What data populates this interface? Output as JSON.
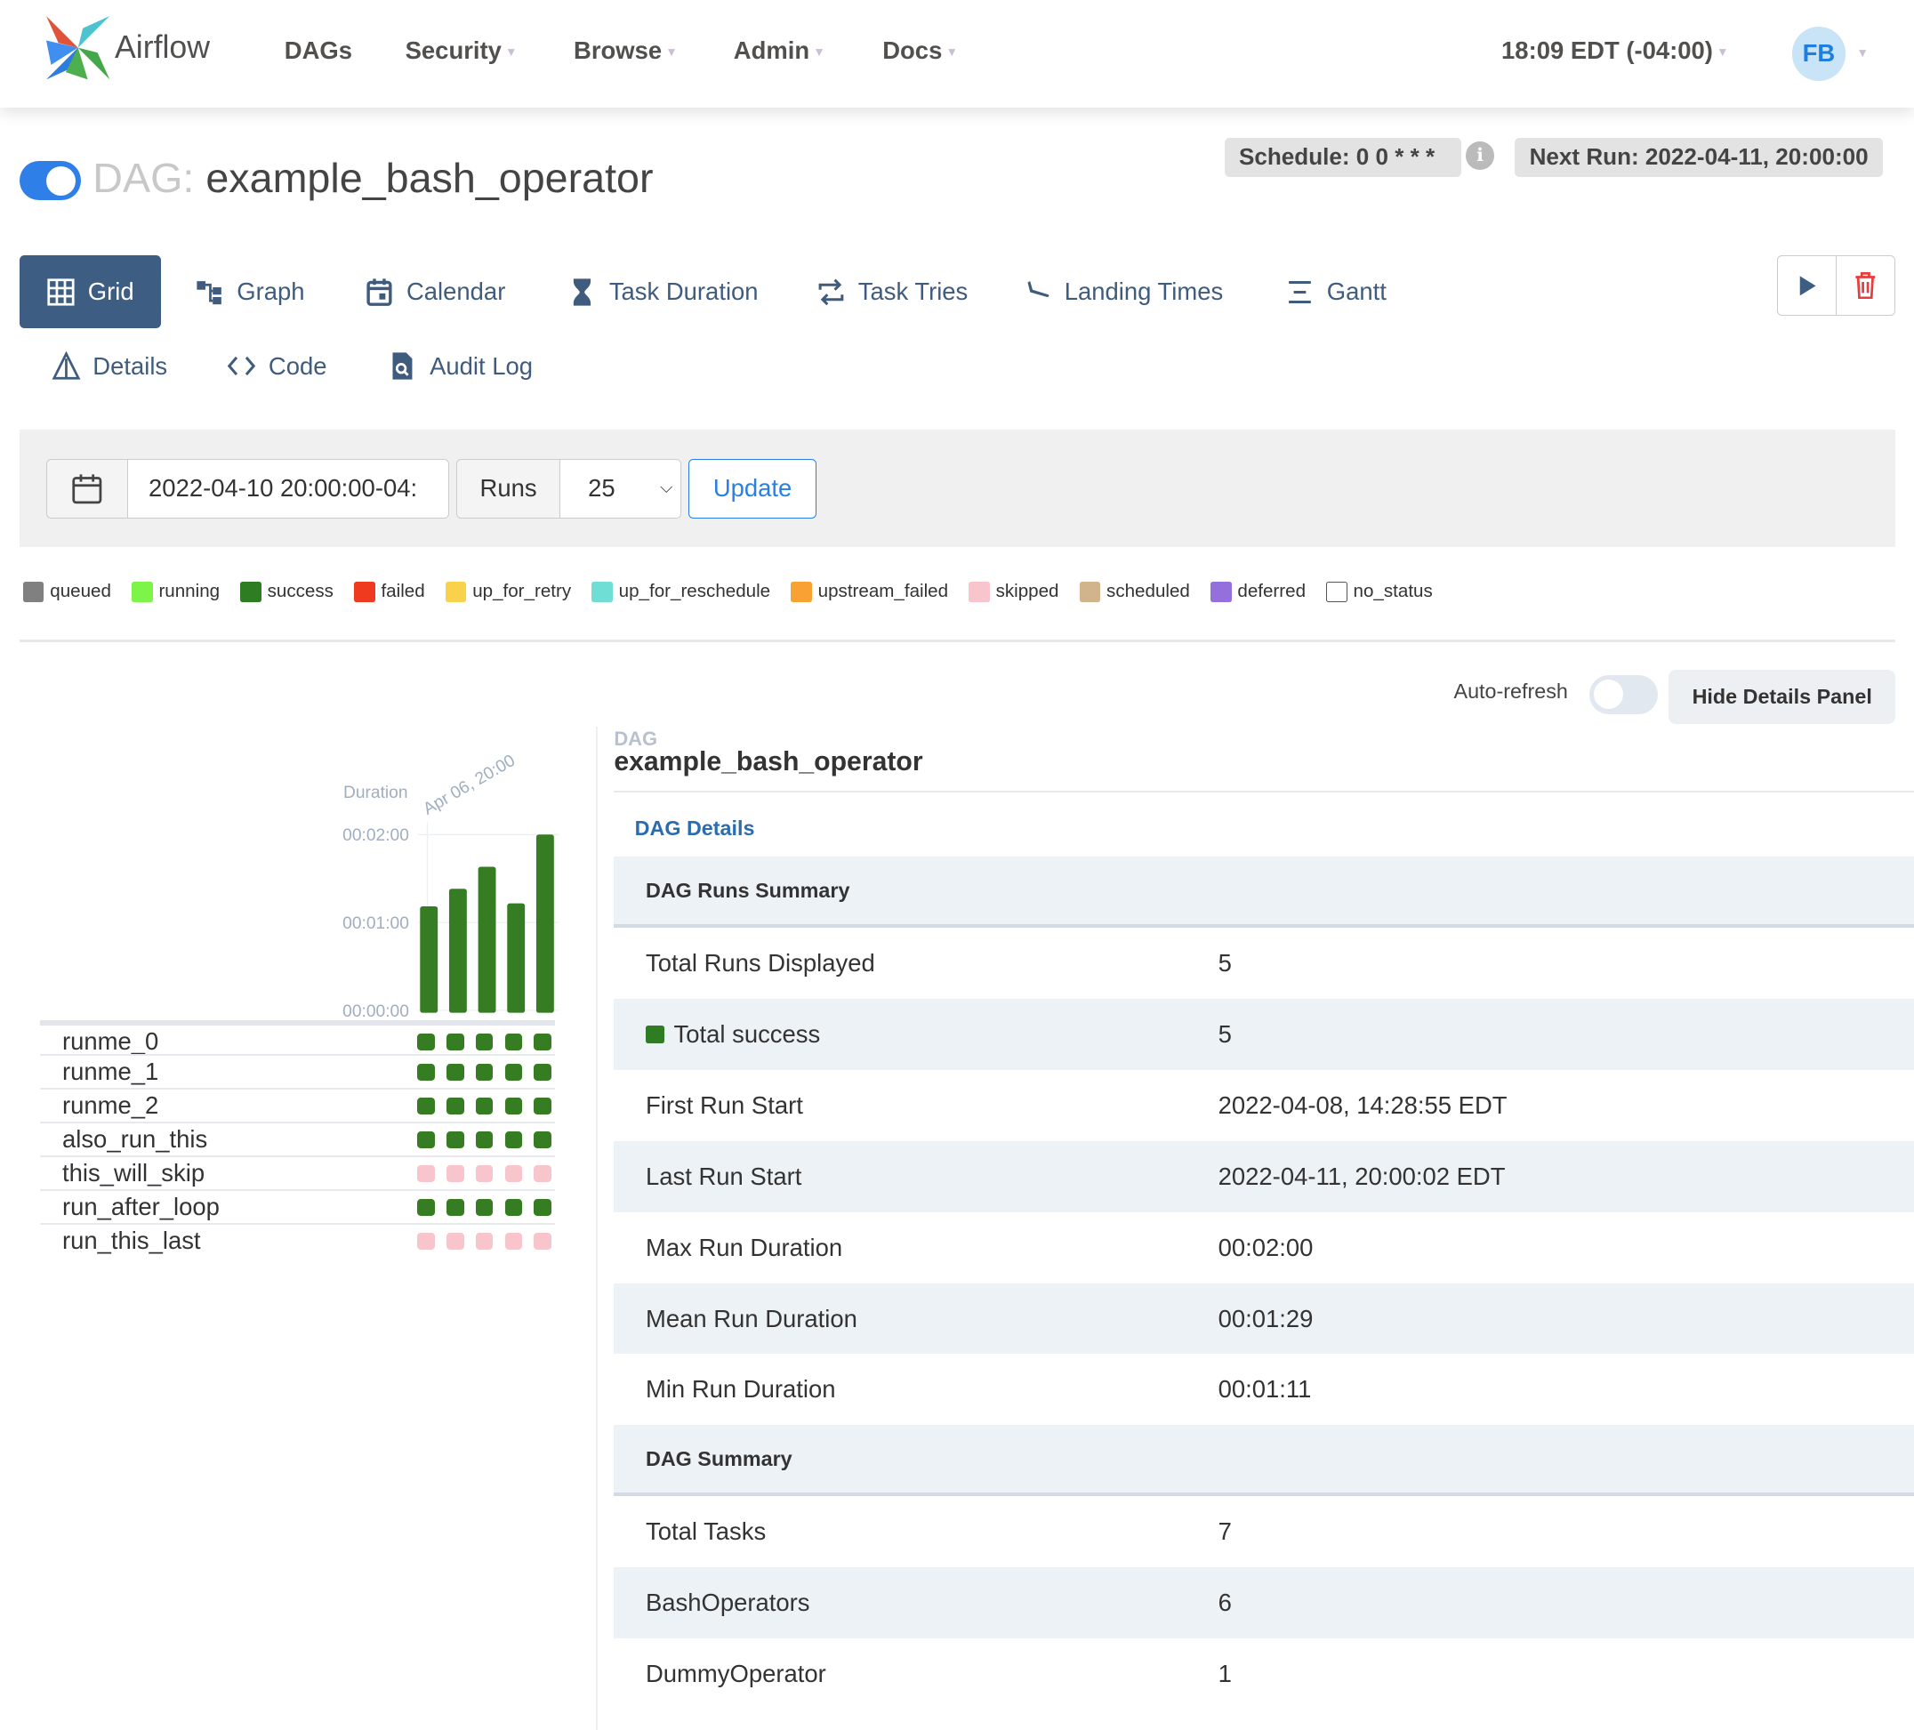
{
  "nav": {
    "brand": "Airflow",
    "items": [
      {
        "label": "DAGs",
        "caret": false
      },
      {
        "label": "Security",
        "caret": true
      },
      {
        "label": "Browse",
        "caret": true
      },
      {
        "label": "Admin",
        "caret": true
      },
      {
        "label": "Docs",
        "caret": true
      }
    ],
    "time": "18:09 EDT (-04:00)",
    "avatar": "FB"
  },
  "header": {
    "prefix": "DAG:",
    "dag_id": "example_bash_operator",
    "paused": false,
    "schedule": "Schedule: 0 0 * * *",
    "next_run": "Next Run: 2022-04-11, 20:00:00"
  },
  "tabs": [
    {
      "label": "Grid",
      "icon": "grid-icon",
      "active": true
    },
    {
      "label": "Graph",
      "icon": "graph-icon"
    },
    {
      "label": "Calendar",
      "icon": "calendar-icon"
    },
    {
      "label": "Task Duration",
      "icon": "hourglass-icon"
    },
    {
      "label": "Task Tries",
      "icon": "repeat-icon"
    },
    {
      "label": "Landing Times",
      "icon": "plane-landing-icon"
    },
    {
      "label": "Gantt",
      "icon": "gantt-icon"
    }
  ],
  "tabs2": [
    {
      "label": "Details",
      "icon": "warning-triangle-icon"
    },
    {
      "label": "Code",
      "icon": "code-icon"
    },
    {
      "label": "Audit Log",
      "icon": "file-search-icon"
    }
  ],
  "filters": {
    "base_date": "2022-04-10 20:00:00-04:",
    "runs_label": "Runs",
    "runs_value": "25",
    "update": "Update"
  },
  "legend": [
    {
      "label": "queued",
      "color": "#808080"
    },
    {
      "label": "running",
      "color": "#7cf548"
    },
    {
      "label": "success",
      "color": "#2f7d22"
    },
    {
      "label": "failed",
      "color": "#f03a1f"
    },
    {
      "label": "up_for_retry",
      "color": "#fad14a"
    },
    {
      "label": "up_for_reschedule",
      "color": "#6fded4"
    },
    {
      "label": "upstream_failed",
      "color": "#f7a233"
    },
    {
      "label": "skipped",
      "color": "#f7c5cb"
    },
    {
      "label": "scheduled",
      "color": "#d2b48c"
    },
    {
      "label": "deferred",
      "color": "#9370db"
    },
    {
      "label": "no_status",
      "color": "#ffffff"
    }
  ],
  "controls": {
    "auto_refresh": "Auto-refresh",
    "auto_refresh_on": false,
    "hide_details": "Hide Details Panel"
  },
  "chart_data": {
    "type": "bar",
    "ylabel": "Duration",
    "xlabel_first": "Apr 06, 20:00",
    "yticks": [
      "00:00:00",
      "00:01:00",
      "00:02:00"
    ],
    "ylim_seconds": [
      0,
      120
    ],
    "values_seconds": [
      71,
      83,
      98,
      73,
      120
    ],
    "color": "#367c23"
  },
  "tasks": [
    {
      "name": "runme_0",
      "states": [
        "success",
        "success",
        "success",
        "success",
        "success"
      ]
    },
    {
      "name": "runme_1",
      "states": [
        "success",
        "success",
        "success",
        "success",
        "success"
      ]
    },
    {
      "name": "runme_2",
      "states": [
        "success",
        "success",
        "success",
        "success",
        "success"
      ]
    },
    {
      "name": "also_run_this",
      "states": [
        "success",
        "success",
        "success",
        "success",
        "success"
      ]
    },
    {
      "name": "this_will_skip",
      "states": [
        "skipped",
        "skipped",
        "skipped",
        "skipped",
        "skipped"
      ]
    },
    {
      "name": "run_after_loop",
      "states": [
        "success",
        "success",
        "success",
        "success",
        "success"
      ]
    },
    {
      "name": "run_this_last",
      "states": [
        "skipped",
        "skipped",
        "skipped",
        "skipped",
        "skipped"
      ]
    }
  ],
  "details": {
    "label": "DAG",
    "name": "example_bash_operator",
    "link": "DAG Details",
    "rows": [
      {
        "head": "DAG Runs Summary"
      },
      {
        "k": "Total Runs Displayed",
        "v": "5"
      },
      {
        "k": "Total success",
        "v": "5",
        "swatch": "#2f7d22"
      },
      {
        "k": "First Run Start",
        "v": "2022-04-08, 14:28:55 EDT"
      },
      {
        "k": "Last Run Start",
        "v": "2022-04-11, 20:00:02 EDT"
      },
      {
        "k": "Max Run Duration",
        "v": "00:02:00"
      },
      {
        "k": "Mean Run Duration",
        "v": "00:01:29"
      },
      {
        "k": "Min Run Duration",
        "v": "00:01:11"
      },
      {
        "head": "DAG Summary"
      },
      {
        "k": "Total Tasks",
        "v": "7"
      },
      {
        "k": "BashOperators",
        "v": "6"
      },
      {
        "k": "DummyOperator",
        "v": "1"
      }
    ]
  }
}
